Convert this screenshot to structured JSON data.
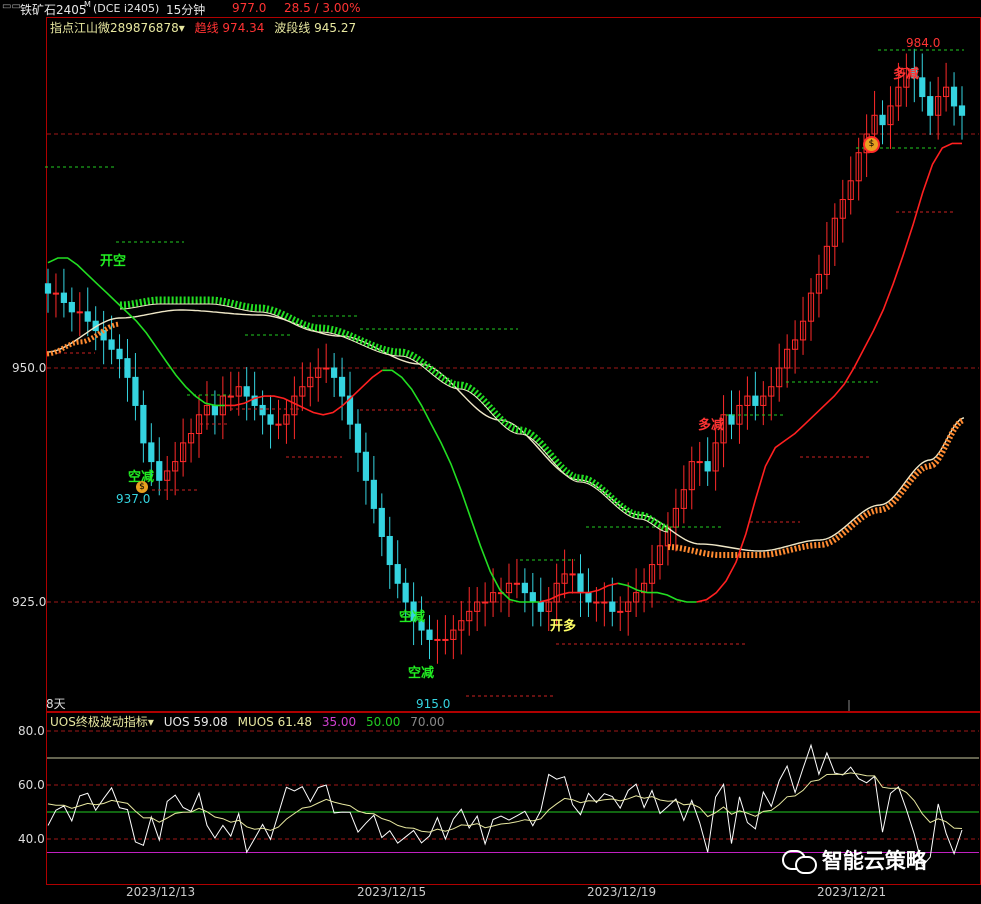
{
  "header": {
    "symbol_glyph": "▭▭",
    "symbol": "铁矿石2405",
    "symbol_sup": "M",
    "code": "(DCE i2405)",
    "period": "15分钟",
    "period_arrow": "▾",
    "last_price": "977.0",
    "change": "28.5 / 3.00%"
  },
  "indicator_line": {
    "name": "指点江山微289876878",
    "arrow": "▾",
    "trend_label": "趋线",
    "trend_value": "974.34",
    "wave_label": "波段线",
    "wave_value": "945.27"
  },
  "main_chart": {
    "y_ticks": [
      "950.0",
      "925.0"
    ],
    "side_label": "8天",
    "annotations": {
      "open_short": "开空",
      "reduce_short_1": "空减",
      "price_low_1": "937.0",
      "reduce_short_2": "空减",
      "reduce_short_3": "空减",
      "price_low_2": "915.0",
      "open_long": "开多",
      "reduce_long_1": "多减",
      "reduce_long_2": "多减",
      "price_high": "984.0",
      "coin_icon": "$"
    }
  },
  "sub_chart": {
    "name": "UOS终极波动指标",
    "arrow": "▾",
    "uos_label": "UOS",
    "uos_value": "59.08",
    "muos_label": "MUOS",
    "muos_value": "61.48",
    "levels": [
      "35.00",
      "50.00",
      "70.00"
    ],
    "y_ticks": [
      "80.0",
      "60.0",
      "40.0"
    ]
  },
  "x_axis": [
    "2023/12/13",
    "2023/12/15",
    "2023/12/19",
    "2023/12/21"
  ],
  "watermark": {
    "icon": "wechat-icon",
    "text": "智能云策略"
  },
  "colors": {
    "up": "#ff2a2a",
    "down": "#35d4e0",
    "trend_line": "#ff2020",
    "green_line": "#22dd22",
    "grid_red": "#a01818",
    "level_35": "#c020c0",
    "level_50": "#22cc22",
    "level_70": "#c8c8a0"
  },
  "chart_data": {
    "type": "candlestick",
    "title": "",
    "y_ticks": [
      950,
      925
    ],
    "ylim": [
      908,
      987
    ],
    "price_marks": {
      "low_1": 937.0,
      "low_2": 915.0,
      "high": 984.0
    },
    "trend_line": [
      961,
      962,
      962,
      961,
      960,
      959,
      958,
      957,
      956,
      955,
      954,
      952,
      951,
      949,
      948,
      947,
      946,
      946,
      946,
      946,
      946,
      947,
      947,
      947,
      947,
      946,
      946,
      945,
      945,
      945,
      946,
      947,
      948,
      949,
      950,
      950,
      949,
      948,
      946,
      944,
      942,
      940,
      937,
      934,
      931,
      928,
      926,
      925,
      925,
      925,
      925,
      925,
      926,
      926,
      926,
      926,
      926,
      927,
      927,
      927,
      926,
      926,
      926,
      926,
      925,
      925,
      925,
      925,
      926,
      927,
      929,
      932,
      936,
      940,
      942,
      942,
      943,
      944,
      945,
      946,
      947,
      948,
      950,
      952,
      954,
      956,
      959,
      962,
      965,
      969,
      972,
      974,
      974,
      974
    ],
    "candles_close": [
      958,
      958,
      957,
      956,
      956,
      955,
      954,
      953,
      952,
      951,
      949,
      946,
      942,
      940,
      938,
      939,
      940,
      942,
      943,
      945,
      946,
      945,
      947,
      947,
      948,
      947,
      946,
      945,
      944,
      944,
      945,
      947,
      948,
      949,
      950,
      950,
      949,
      947,
      944,
      941,
      938,
      935,
      932,
      929,
      927,
      925,
      923,
      922,
      921,
      921,
      921,
      922,
      923,
      924,
      925,
      925,
      926,
      926,
      927,
      927,
      926,
      925,
      924,
      925,
      927,
      928,
      928,
      926,
      925,
      925,
      925,
      924,
      924,
      925,
      926,
      927,
      929,
      931,
      933,
      935,
      937,
      940,
      940,
      939,
      942,
      945,
      944,
      946,
      947,
      946,
      947,
      948,
      950,
      952,
      953,
      955,
      958,
      960,
      963,
      966,
      968,
      970,
      973,
      975,
      977,
      976,
      978,
      980,
      982,
      981,
      979,
      977,
      979,
      980,
      978,
      977
    ]
  }
}
